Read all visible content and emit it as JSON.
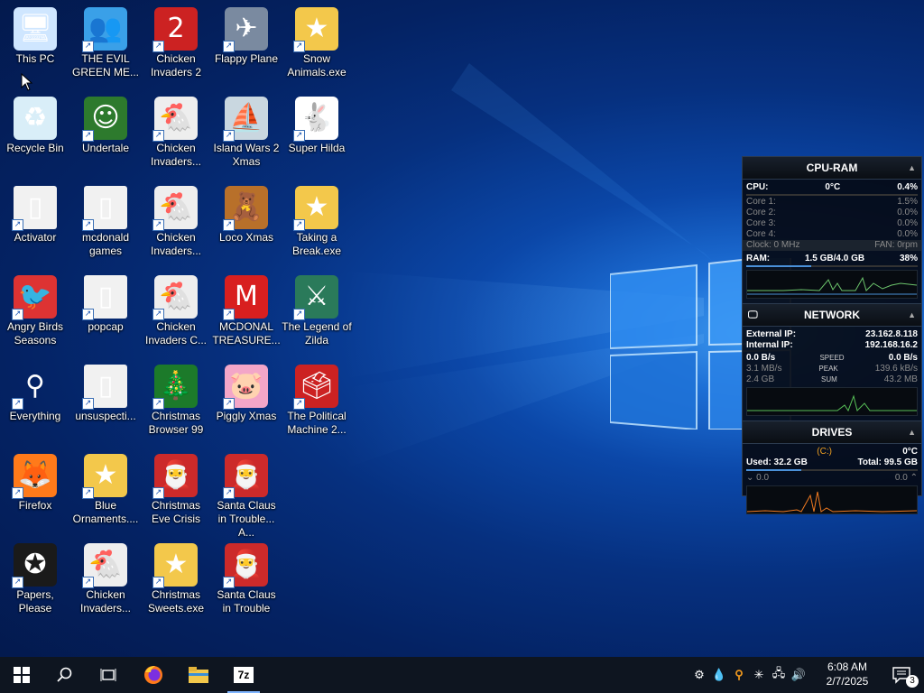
{
  "desktop": {
    "icons": [
      {
        "label": "This PC",
        "icon": "this-pc-icon"
      },
      {
        "label": "Recycle Bin",
        "icon": "recycle-bin-icon"
      },
      {
        "label": "Activator",
        "icon": "folder-icon"
      },
      {
        "label": "Angry Birds Seasons",
        "icon": "angry-birds-icon"
      },
      {
        "label": "Everything",
        "icon": "everything-search-icon"
      },
      {
        "label": "Firefox",
        "icon": "firefox-icon"
      },
      {
        "label": "Papers, Please",
        "icon": "papers-please-icon"
      },
      {
        "label": "THE EVIL GREEN ME...",
        "icon": "messenger-icon"
      },
      {
        "label": "Undertale",
        "icon": "undertale-icon"
      },
      {
        "label": "mcdonald games",
        "icon": "folder-icon"
      },
      {
        "label": "popcap",
        "icon": "folder-icon"
      },
      {
        "label": "unsuspecti...",
        "icon": "folder-icon"
      },
      {
        "label": "Blue Ornaments....",
        "icon": "exe-icon"
      },
      {
        "label": "Chicken Invaders...",
        "icon": "chicken-invaders-icon"
      },
      {
        "label": "Chicken Invaders 2",
        "icon": "chicken-invaders-2-icon"
      },
      {
        "label": "Chicken Invaders...",
        "icon": "chicken-invaders-icon"
      },
      {
        "label": "Chicken Invaders...",
        "icon": "chicken-invaders-icon"
      },
      {
        "label": "Chicken Invaders C...",
        "icon": "chicken-invaders-icon"
      },
      {
        "label": "Christmas Browser 99",
        "icon": "christmas-tree-icon"
      },
      {
        "label": "Christmas Eve Crisis",
        "icon": "santa-icon"
      },
      {
        "label": "Christmas Sweets.exe",
        "icon": "exe-icon"
      },
      {
        "label": "Flappy Plane",
        "icon": "flappy-plane-icon"
      },
      {
        "label": "Island Wars 2 Xmas",
        "icon": "island-wars-icon"
      },
      {
        "label": "Loco Xmas",
        "icon": "bear-icon"
      },
      {
        "label": "MCDONAL TREASURE...",
        "icon": "mcdonalds-icon"
      },
      {
        "label": "Piggly Xmas",
        "icon": "pig-icon"
      },
      {
        "label": "Santa Claus in Trouble... A...",
        "icon": "santa-icon"
      },
      {
        "label": "Santa Claus in Trouble",
        "icon": "santa-icon"
      },
      {
        "label": "Snow Animals.exe",
        "icon": "exe-icon"
      },
      {
        "label": "Super Hilda",
        "icon": "super-hilda-icon"
      },
      {
        "label": "Taking a Break.exe",
        "icon": "exe-icon"
      },
      {
        "label": "The Legend of Zilda",
        "icon": "legend-zilda-icon"
      },
      {
        "label": "The Political Machine 2...",
        "icon": "political-machine-icon"
      }
    ]
  },
  "gadget": {
    "cpu": {
      "title": "CPU-RAM",
      "cpu_label": "CPU:",
      "cpu_temp": "0°C",
      "cpu_pct": "0.4%",
      "cores": [
        {
          "label": "Core 1:",
          "value": "1.5%"
        },
        {
          "label": "Core 2:",
          "value": "0.0%"
        },
        {
          "label": "Core 3:",
          "value": "0.0%"
        },
        {
          "label": "Core 4:",
          "value": "0.0%"
        }
      ],
      "clock": "Clock: 0 MHz",
      "fan": "FAN: 0rpm",
      "ram_label": "RAM:",
      "ram_value": "1.5 GB/4.0 GB",
      "ram_pct": "38%"
    },
    "network": {
      "title": "NETWORK",
      "ext_label": "External IP:",
      "ext_ip": "23.162.8.118",
      "int_label": "Internal IP:",
      "int_ip": "192.168.16.2",
      "speed_l": "0.0 B/s",
      "speed_tag": "SPEED",
      "speed_r": "0.0 B/s",
      "peak_l": "3.1 MB/s",
      "peak_tag": "PEAK",
      "peak_r": "139.6 kB/s",
      "sum_l": "2.4 GB",
      "sum_tag": "SUM",
      "sum_r": "43.2 MB"
    },
    "drives": {
      "title": "DRIVES",
      "drive": "(C:)",
      "temp": "0°C",
      "used": "Used: 32.2 GB",
      "total": "Total: 99.5 GB",
      "read": "0.0",
      "write": "0.0"
    }
  },
  "taskbar": {
    "time": "6:08 AM",
    "date": "2/7/2025",
    "notifications": "3",
    "zip_label": "7z"
  }
}
